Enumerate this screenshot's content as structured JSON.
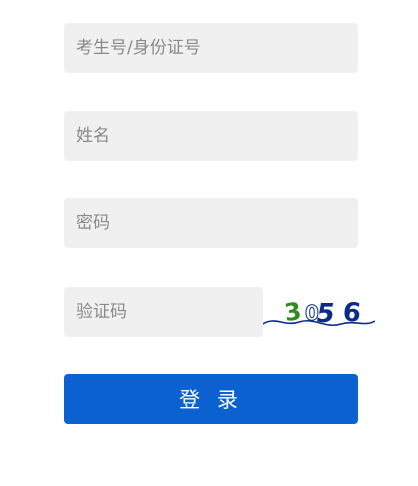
{
  "form": {
    "id_number": {
      "placeholder": "考生号/身份证号",
      "value": ""
    },
    "name": {
      "placeholder": "姓名",
      "value": ""
    },
    "password": {
      "placeholder": "密码",
      "value": ""
    },
    "captcha_input": {
      "placeholder": "验证码",
      "value": ""
    },
    "captcha_image_text": "3056",
    "login_label": "登 录"
  },
  "colors": {
    "field_bg": "#f0f0f0",
    "placeholder": "#8a8a8a",
    "button_bg": "#0b61d0",
    "button_text": "#ffffff",
    "captcha_green": "#2e8b1e",
    "captcha_navy": "#0a2a8c"
  }
}
